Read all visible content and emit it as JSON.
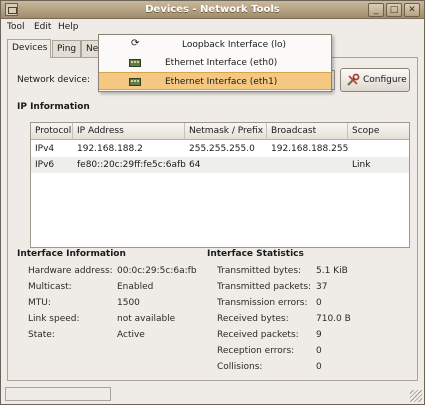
{
  "window": {
    "title": "Devices - Network Tools"
  },
  "menu": [
    "Tool",
    "Edit",
    "Help"
  ],
  "tabs": [
    "Devices",
    "Ping",
    "Net"
  ],
  "device": {
    "label": "Network device:",
    "configure_label": "Configure"
  },
  "dropdown": {
    "options": [
      {
        "label": "Loopback Interface (lo)",
        "icon": "loopback-icon"
      },
      {
        "label": "Ethernet Interface (eth0)",
        "icon": "ethernet-icon"
      },
      {
        "label": "Ethernet Interface (eth1)",
        "icon": "ethernet-icon",
        "selected": true
      }
    ]
  },
  "ip_info": {
    "heading": "IP Information",
    "columns": [
      "Protocol",
      "IP Address",
      "Netmask / Prefix",
      "Broadcast",
      "Scope"
    ],
    "rows": [
      {
        "protocol": "IPv4",
        "ip": "192.168.188.2",
        "netmask": "255.255.255.0",
        "broadcast": "192.168.188.255",
        "scope": ""
      },
      {
        "protocol": "IPv6",
        "ip": "fe80::20c:29ff:fe5c:6afb",
        "netmask": "64",
        "broadcast": "",
        "scope": "Link"
      }
    ]
  },
  "interface_info": {
    "heading": "Interface Information",
    "items": [
      {
        "label": "Hardware address:",
        "value": "00:0c:29:5c:6a:fb"
      },
      {
        "label": "Multicast:",
        "value": "Enabled"
      },
      {
        "label": "MTU:",
        "value": "1500"
      },
      {
        "label": "Link speed:",
        "value": "not available"
      },
      {
        "label": "State:",
        "value": "Active"
      }
    ]
  },
  "interface_stats": {
    "heading": "Interface Statistics",
    "items": [
      {
        "label": "Transmitted bytes:",
        "value": "5.1 KiB"
      },
      {
        "label": "Transmitted packets:",
        "value": "37"
      },
      {
        "label": "Transmission errors:",
        "value": "0"
      },
      {
        "label": "Received bytes:",
        "value": "710.0 B"
      },
      {
        "label": "Received packets:",
        "value": "9"
      },
      {
        "label": "Reception errors:",
        "value": "0"
      },
      {
        "label": "Collisions:",
        "value": "0"
      }
    ]
  },
  "colors": {
    "titlebar": "#b3a07f",
    "selection": "#f4c881",
    "window_bg": "#efebe7"
  }
}
